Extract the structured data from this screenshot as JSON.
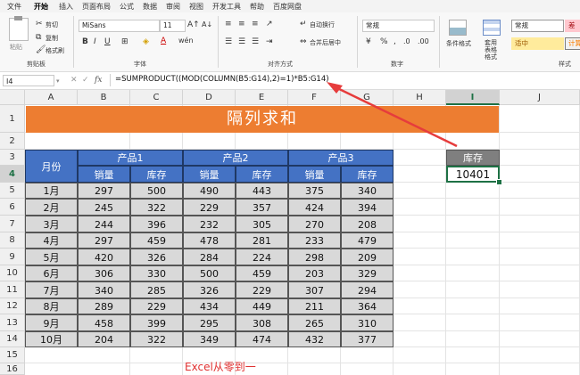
{
  "menu": [
    "文件",
    "开始",
    "插入",
    "页面布局",
    "公式",
    "数据",
    "审阅",
    "视图",
    "开发工具",
    "帮助",
    "百度网盘"
  ],
  "menu_active_index": 1,
  "ribbon": {
    "paste_label": "粘贴",
    "cut_label": "剪切",
    "copy_label": "复制",
    "format_painter_label": "格式刷",
    "clipboard_group": "剪贴板",
    "font_name": "MiSans",
    "font_size": "11",
    "font_group": "字体",
    "wrap_text_label": "自动换行",
    "merge_center_label": "合并后居中",
    "alignment_group": "对齐方式",
    "number_format": "常规",
    "number_group": "数字",
    "conditional_format_label": "条件格式",
    "format_as_table_label": "套用表格格式",
    "style_normal": "常规",
    "style_bad": "差",
    "style_neutral": "适中",
    "style_calc": "计算",
    "styles_group": "样式"
  },
  "formula_bar": {
    "name_box": "I4",
    "fx": "fx",
    "formula": "=SUMPRODUCT((MOD(COLUMN(B5:G14),2)=1)*B5:G14)"
  },
  "columns": [
    "A",
    "B",
    "C",
    "D",
    "E",
    "F",
    "G",
    "H",
    "I",
    "J"
  ],
  "selected_column": "I",
  "rows": [
    "1",
    "2",
    "3",
    "4",
    "5",
    "6",
    "7",
    "8",
    "9",
    "10",
    "11",
    "12",
    "13",
    "14",
    "15",
    "16"
  ],
  "selected_row": "4",
  "sheet": {
    "title": "隔列求和",
    "month_header": "月份",
    "products": [
      "产品1",
      "产品2",
      "产品3"
    ],
    "sub_headers": [
      "销量",
      "库存",
      "销量",
      "库存",
      "销量",
      "库存"
    ],
    "months": [
      "1月",
      "2月",
      "3月",
      "4月",
      "5月",
      "6月",
      "7月",
      "8月",
      "9月",
      "10月"
    ],
    "data": [
      [
        "297",
        "500",
        "490",
        "443",
        "375",
        "340"
      ],
      [
        "245",
        "322",
        "229",
        "357",
        "424",
        "394"
      ],
      [
        "244",
        "396",
        "232",
        "305",
        "270",
        "208"
      ],
      [
        "297",
        "459",
        "478",
        "281",
        "233",
        "479"
      ],
      [
        "420",
        "326",
        "284",
        "224",
        "298",
        "209"
      ],
      [
        "306",
        "330",
        "500",
        "459",
        "203",
        "329"
      ],
      [
        "340",
        "285",
        "326",
        "229",
        "307",
        "294"
      ],
      [
        "289",
        "229",
        "434",
        "449",
        "211",
        "364"
      ],
      [
        "458",
        "399",
        "295",
        "308",
        "265",
        "310"
      ],
      [
        "204",
        "322",
        "349",
        "474",
        "432",
        "377"
      ]
    ],
    "stock_label": "库存",
    "stock_value": "10401",
    "watermark": "Excel从零到一"
  },
  "colors": {
    "title_band": "#ed7d31",
    "header_blue": "#4472c4",
    "data_gray": "#d9d9d9",
    "accent_green": "#1e7145",
    "arrow_red": "#e63c3c"
  }
}
